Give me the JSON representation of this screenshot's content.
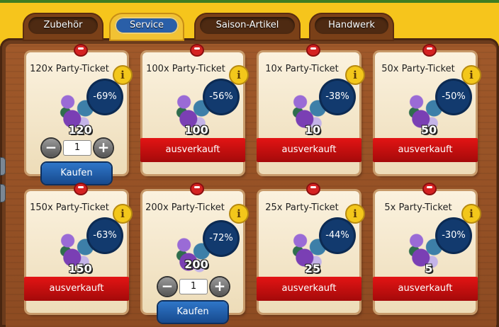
{
  "tabs": [
    {
      "label": "Zubehör",
      "active": false
    },
    {
      "label": "Service",
      "active": true
    },
    {
      "label": "Saison-Artikel",
      "active": false
    },
    {
      "label": "Handwerk",
      "active": false
    }
  ],
  "cards": [
    {
      "title": "120x Party-Ticket",
      "discount": "-69%",
      "quantity": "120",
      "status": "buy",
      "stepper_value": "1",
      "buy_label": "Kaufen"
    },
    {
      "title": "100x Party-Ticket",
      "discount": "-56%",
      "quantity": "100",
      "status": "sold",
      "sold_label": "ausverkauft"
    },
    {
      "title": "10x Party-Ticket",
      "discount": "-38%",
      "quantity": "10",
      "status": "sold",
      "sold_label": "ausverkauft"
    },
    {
      "title": "50x Party-Ticket",
      "discount": "-50%",
      "quantity": "50",
      "status": "sold",
      "sold_label": "ausverkauft"
    },
    {
      "title": "150x Party-Ticket",
      "discount": "-63%",
      "quantity": "150",
      "status": "sold",
      "sold_label": "ausverkauft"
    },
    {
      "title": "200x Party-Ticket",
      "discount": "-72%",
      "quantity": "200",
      "status": "buy",
      "stepper_value": "1",
      "buy_label": "Kaufen"
    },
    {
      "title": "25x Party-Ticket",
      "discount": "-44%",
      "quantity": "25",
      "status": "sold",
      "sold_label": "ausverkauft"
    },
    {
      "title": "5x Party-Ticket",
      "discount": "-30%",
      "quantity": "5",
      "status": "sold",
      "sold_label": "ausverkauft"
    }
  ],
  "icons": {
    "info": "i",
    "minus": "−",
    "plus": "+"
  },
  "colors": {
    "sold_out_red": "#d01010",
    "buy_blue": "#1f5aa8",
    "active_tab": "#f2c233",
    "badge_navy": "#123a6e"
  }
}
